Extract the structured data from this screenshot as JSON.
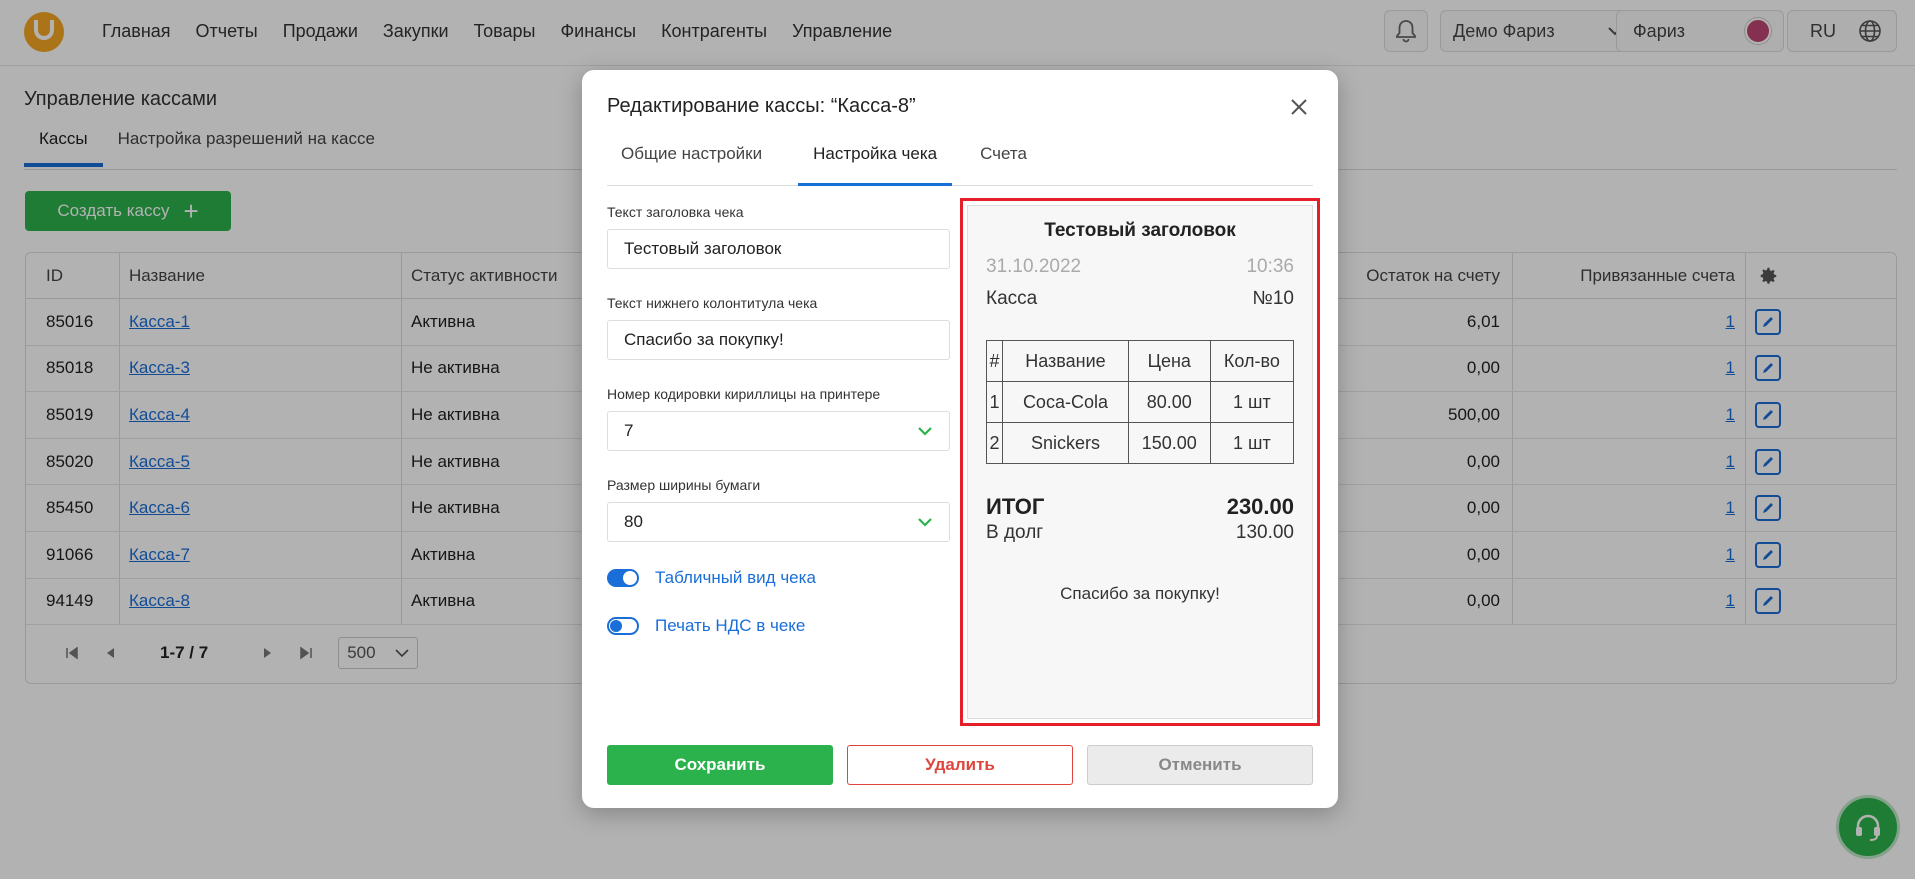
{
  "nav": {
    "logo": "U",
    "items": [
      "Главная",
      "Отчеты",
      "Продажи",
      "Закупки",
      "Товары",
      "Финансы",
      "Контрагенты",
      "Управление"
    ],
    "org": "Демо Фариз",
    "user": "Фариз",
    "lang": "RU"
  },
  "page": {
    "title": "Управление кассами",
    "tabs": [
      "Кассы",
      "Настройка разрешений на кассе"
    ],
    "create_button": "Создать кассу"
  },
  "table": {
    "headers": [
      "ID",
      "Название",
      "Статус активности",
      "Остаток на счету",
      "Привязанные счета"
    ],
    "rows": [
      {
        "id": "85016",
        "name": "Касса-1",
        "status": "Активна",
        "balance": "6,01",
        "accounts": "1"
      },
      {
        "id": "85018",
        "name": "Касса-3",
        "status": "Не активна",
        "balance": "0,00",
        "accounts": "1"
      },
      {
        "id": "85019",
        "name": "Касса-4",
        "status": "Не активна",
        "balance": "500,00",
        "accounts": "1"
      },
      {
        "id": "85020",
        "name": "Касса-5",
        "status": "Не активна",
        "balance": "0,00",
        "accounts": "1"
      },
      {
        "id": "85450",
        "name": "Касса-6",
        "status": "Не активна",
        "balance": "0,00",
        "accounts": "1"
      },
      {
        "id": "91066",
        "name": "Касса-7",
        "status": "Активна",
        "balance": "0,00",
        "accounts": "1"
      },
      {
        "id": "94149",
        "name": "Касса-8",
        "status": "Активна",
        "balance": "0,00",
        "accounts": "1"
      }
    ],
    "pager": {
      "range": "1-7 / 7",
      "page_size": "500"
    }
  },
  "modal": {
    "title": "Редактирование кассы: “Касса-8”",
    "tabs": [
      "Общие настройки",
      "Настройка чека",
      "Счета"
    ],
    "active_tab": "Настройка чека",
    "fields": {
      "header_label": "Текст заголовка чека",
      "header_value": "Тестовый заголовок",
      "footer_label": "Текст нижнего колонтитула чека",
      "footer_value": "Спасибо за покупку!",
      "codepage_label": "Номер кодировки кириллицы на принтере",
      "codepage_value": "7",
      "paper_label": "Размер ширины бумаги",
      "paper_value": "80",
      "toggle_table": "Табличный вид чека",
      "toggle_vat": "Печать НДС в чеке"
    },
    "toggles": {
      "table_view": true,
      "print_vat": false
    },
    "receipt": {
      "header": "Тестовый заголовок",
      "date": "31.10.2022",
      "time": "10:36",
      "register_label": "Касса",
      "register_no": "№10",
      "columns": [
        "#",
        "Название",
        "Цена",
        "Кол-во"
      ],
      "items": [
        {
          "n": "1",
          "name": "Coca-Cola",
          "price": "80.00",
          "qty": "1 шт"
        },
        {
          "n": "2",
          "name": "Snickers",
          "price": "150.00",
          "qty": "1 шт"
        }
      ],
      "total_label": "ИТОГ",
      "total_value": "230.00",
      "debt_label": "В долг",
      "debt_value": "130.00",
      "footer": "Спасибо за покупку!"
    },
    "buttons": {
      "save": "Сохранить",
      "delete": "Удалить",
      "cancel": "Отменить"
    }
  },
  "colors": {
    "accent": "#1a6ed8",
    "green": "#2bb24c",
    "danger": "#e0453d",
    "highlight": "#e51e2a"
  }
}
